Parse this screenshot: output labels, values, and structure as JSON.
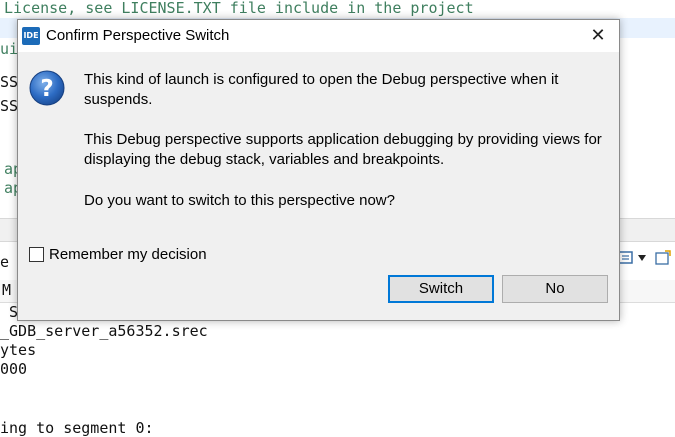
{
  "background": {
    "editor_lines": [
      {
        "text": "License, see LICENSE.TXT file include in the project",
        "style": "green"
      },
      {
        "text": "uis",
        "style": "green"
      },
      {
        "text": "SSI",
        "style": "black"
      },
      {
        "text": "SSI",
        "style": "black"
      },
      {
        "text": "ap",
        "style": "green"
      },
      {
        "text": "ap",
        "style": "green"
      }
    ],
    "console_lines": [
      "e S",
      "M",
      " S",
      "_GDB_server_a56352.srec",
      "ytes",
      "000",
      "ing to segment 0:"
    ]
  },
  "dialog": {
    "title": "Confirm Perspective Switch",
    "icon_text": "IDE",
    "close_glyph": "✕",
    "message_1": "This kind of launch is configured to open the Debug perspective when it suspends.",
    "message_2": "This Debug perspective supports application debugging by providing views for displaying the debug stack, variables and breakpoints.",
    "message_3": "Do you want to switch to this perspective now?",
    "remember_label": "Remember my decision",
    "remember_checked": false,
    "switch_label": "Switch",
    "no_label": "No"
  },
  "colors": {
    "accent": "#0078d7",
    "question_icon": "#1f5fb5",
    "comment_green": "#3f7f5f"
  }
}
